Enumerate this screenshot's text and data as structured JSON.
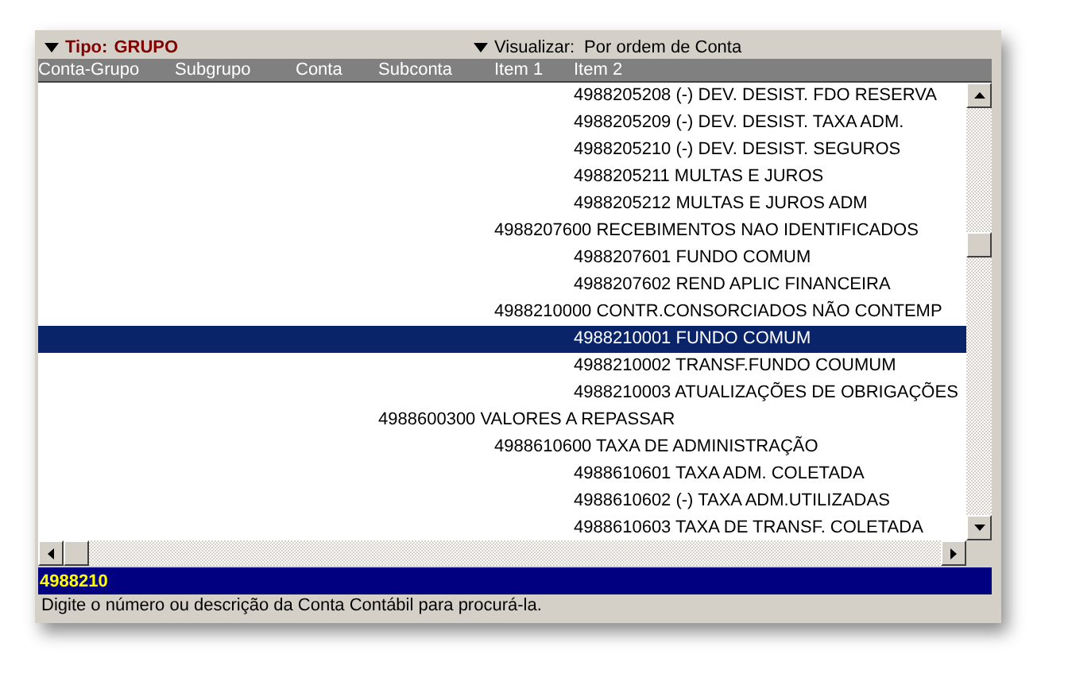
{
  "header": {
    "tipo": {
      "label": "Tipo:",
      "value": "GRUPO"
    },
    "visualizar": {
      "label": "Visualizar:",
      "value": "Por ordem de Conta"
    }
  },
  "columns": [
    "Conta-Grupo",
    "Subgrupo",
    "Conta",
    "Subconta",
    "Item 1",
    "Item 2"
  ],
  "rows": [
    {
      "children": [
        {
          "children": [
            {
              "text": "4988205208 (-) DEV. DESIST. FDO RESERVA",
              "selected": false
            },
            {
              "text": "4988205209 (-) DEV. DESIST. TAXA ADM.",
              "selected": false
            },
            {
              "text": "4988205210 (-) DEV. DESIST. SEGUROS",
              "selected": false
            },
            {
              "text": "4988205211 MULTAS E JUROS",
              "selected": false
            },
            {
              "text": "4988205212 MULTAS E JUROS ADM",
              "selected": false
            }
          ]
        },
        {
          "text": "4988207600 RECEBIMENTOS NAO IDENTIFICADOS",
          "selected": false,
          "children": [
            {
              "text": "4988207601 FUNDO COMUM",
              "selected": false
            },
            {
              "text": "4988207602 REND APLIC FINANCEIRA",
              "selected": false
            }
          ]
        },
        {
          "text": "4988210000 CONTR.CONSORCIADOS NÃO CONTEMP",
          "selected": false,
          "children": [
            {
              "text": "4988210001 FUNDO COMUM",
              "selected": true
            },
            {
              "text": "4988210002 TRANSF.FUNDO COUMUM",
              "selected": false
            },
            {
              "text": "4988210003 ATUALIZAÇÕES DE OBRIGAÇÕES",
              "selected": false
            }
          ]
        }
      ]
    },
    {
      "text": "4988600300 VALORES A REPASSAR",
      "selected": false,
      "children": [
        {
          "text": "4988610600 TAXA DE ADMINISTRAÇÃO",
          "selected": false,
          "children": [
            {
              "text": "4988610601 TAXA ADM. COLETADA",
              "selected": false
            },
            {
              "text": "4988610602 (-) TAXA ADM.UTILIZADAS",
              "selected": false
            },
            {
              "text": "4988610603 TAXA DE TRANSF. COLETADA",
              "selected": false
            }
          ]
        }
      ]
    }
  ],
  "search": {
    "value": "4988210"
  },
  "status": "Digite o número ou descrição da Conta Contábil para procurá-la."
}
